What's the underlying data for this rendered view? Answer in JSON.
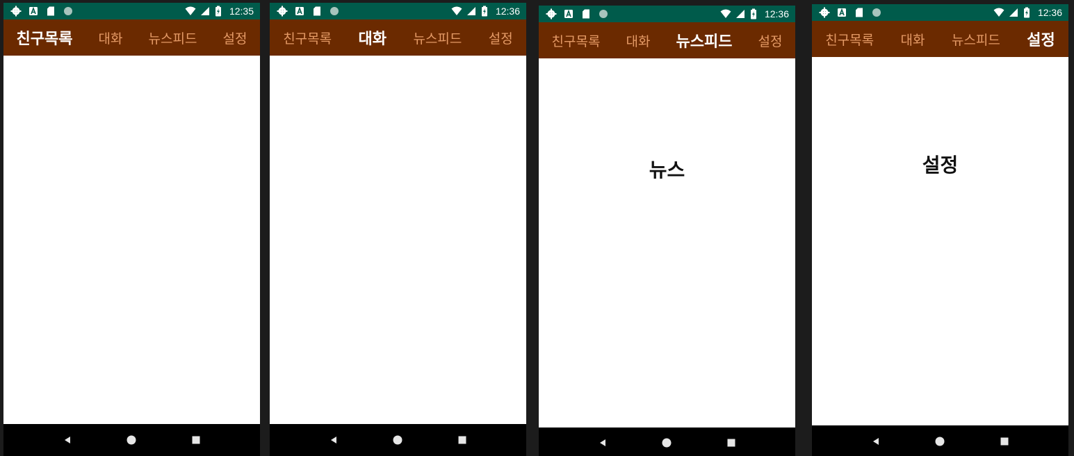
{
  "screens": [
    {
      "status": {
        "time": "12:35"
      },
      "tabs": [
        "친구목록",
        "대화",
        "뉴스피드",
        "설정"
      ],
      "active_tab_index": 0,
      "content_text": ""
    },
    {
      "status": {
        "time": "12:36"
      },
      "tabs": [
        "친구목록",
        "대화",
        "뉴스피드",
        "설정"
      ],
      "active_tab_index": 1,
      "content_text": ""
    },
    {
      "status": {
        "time": "12:36"
      },
      "tabs": [
        "친구목록",
        "대화",
        "뉴스피드",
        "설정"
      ],
      "active_tab_index": 2,
      "content_text": "뉴스"
    },
    {
      "status": {
        "time": "12:36"
      },
      "tabs": [
        "친구목록",
        "대화",
        "뉴스피드",
        "설정"
      ],
      "active_tab_index": 3,
      "content_text": "설정"
    }
  ],
  "icons": {
    "status_left": [
      "gear-icon",
      "a-box-icon",
      "sd-card-icon",
      "circle-icon"
    ],
    "status_right": [
      "wifi-icon",
      "signal-icon",
      "battery-charging-icon"
    ],
    "navigation": [
      "back-icon",
      "home-icon",
      "recents-icon"
    ]
  },
  "colors": {
    "status_bar": "#005b4b",
    "tab_bar": "#6b2a00",
    "tab_inactive": "#e49a66",
    "tab_active": "#ffffff",
    "nav_bar": "#000000",
    "content_bg": "#ffffff"
  }
}
